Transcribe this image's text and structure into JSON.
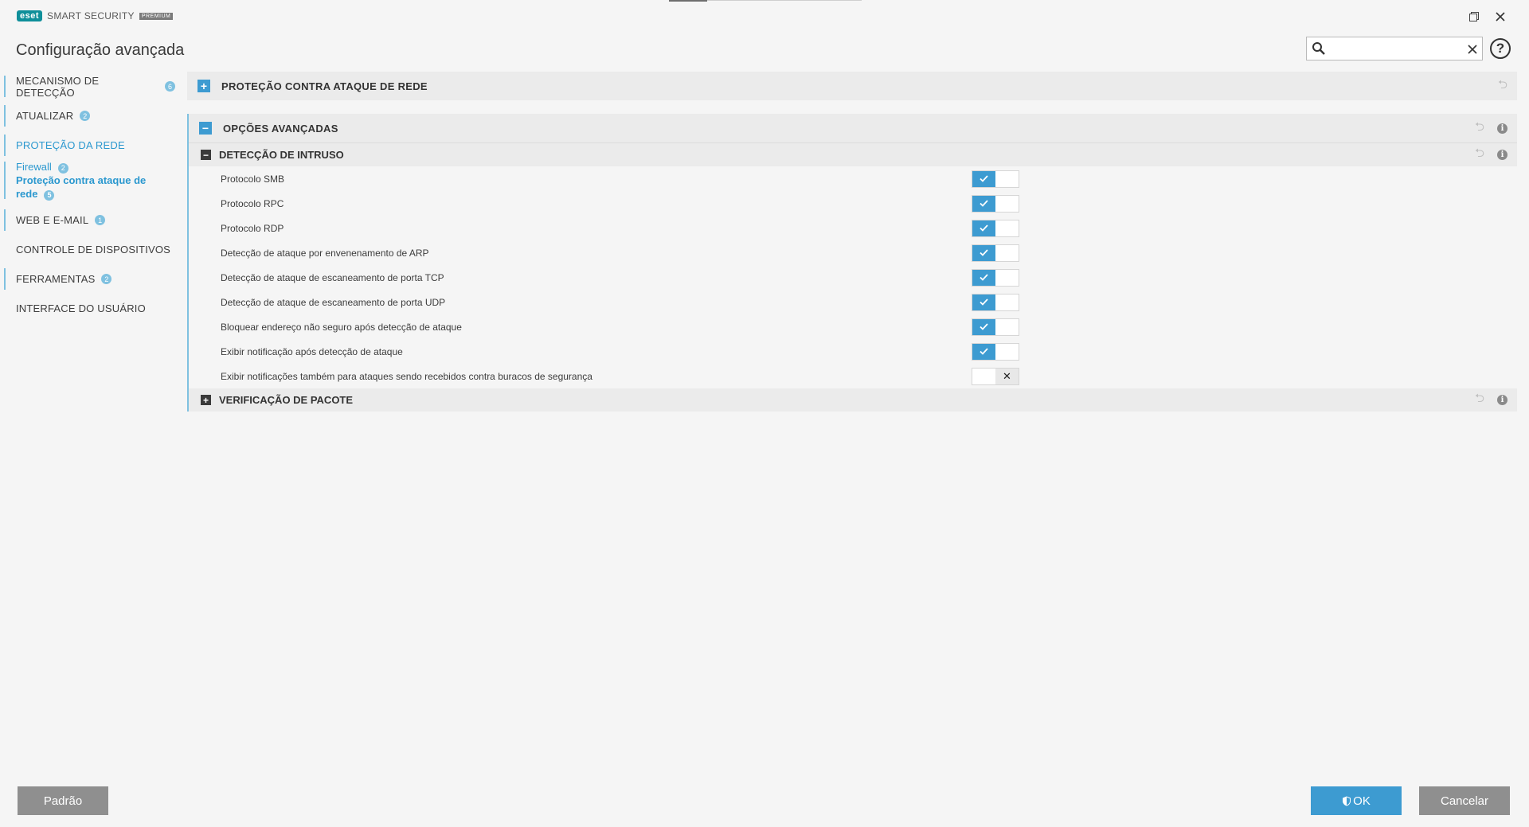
{
  "app": {
    "brand": "eset",
    "product": "SMART SECURITY",
    "edition": "PREMIUM"
  },
  "page_title": "Configuração avançada",
  "search": {
    "value": "",
    "placeholder": ""
  },
  "sidebar": {
    "items": [
      {
        "label": "MECANISMO DE DETECÇÃO",
        "badge": "6"
      },
      {
        "label": "ATUALIZAR",
        "badge": "2"
      },
      {
        "label": "PROTEÇÃO DA REDE",
        "badge": ""
      },
      {
        "label": "WEB E E-MAIL",
        "badge": "1"
      },
      {
        "label": "CONTROLE DE DISPOSITIVOS",
        "badge": ""
      },
      {
        "label": "FERRAMENTAS",
        "badge": "2"
      },
      {
        "label": "INTERFACE DO USUÁRIO",
        "badge": ""
      }
    ],
    "subitems": [
      {
        "label": "Firewall",
        "badge": "2"
      },
      {
        "label": "Proteção contra ataque de rede",
        "badge": "5"
      }
    ]
  },
  "sections": {
    "network_attack": {
      "title": "PROTEÇÃO CONTRA ATAQUE DE REDE",
      "expand": "+"
    },
    "advanced": {
      "title": "OPÇÕES AVANÇADAS",
      "expand": "−"
    },
    "intrusion": {
      "title": "DETECÇÃO DE INTRUSO",
      "expand": "−"
    },
    "packet": {
      "title": "VERIFICAÇÃO DE PACOTE",
      "expand": "+"
    }
  },
  "settings": [
    {
      "label": "Protocolo SMB",
      "enabled": true
    },
    {
      "label": "Protocolo RPC",
      "enabled": true
    },
    {
      "label": "Protocolo RDP",
      "enabled": true
    },
    {
      "label": "Detecção de ataque por envenenamento de ARP",
      "enabled": true
    },
    {
      "label": "Detecção de ataque de escaneamento de porta TCP",
      "enabled": true
    },
    {
      "label": "Detecção de ataque de escaneamento de porta UDP",
      "enabled": true
    },
    {
      "label": "Bloquear endereço não seguro após detecção de ataque",
      "enabled": true
    },
    {
      "label": "Exibir notificação após detecção de ataque",
      "enabled": true
    },
    {
      "label": "Exibir notificações também para ataques sendo recebidos contra buracos de segurança",
      "enabled": false
    }
  ],
  "buttons": {
    "default": "Padrão",
    "ok": "OK",
    "cancel": "Cancelar"
  },
  "icons": {
    "restore": "restore-window-icon",
    "close": "close-icon",
    "search": "search-icon",
    "help": "help-icon",
    "revert": "revert-icon",
    "info": "info-icon",
    "shield": "shield-icon"
  },
  "colors": {
    "accent": "#3d9bd1",
    "accent_light": "#7fc1e0",
    "button_gray": "#8f8f8f",
    "header_bg": "#ebebeb",
    "page_bg": "#f5f5f5"
  }
}
